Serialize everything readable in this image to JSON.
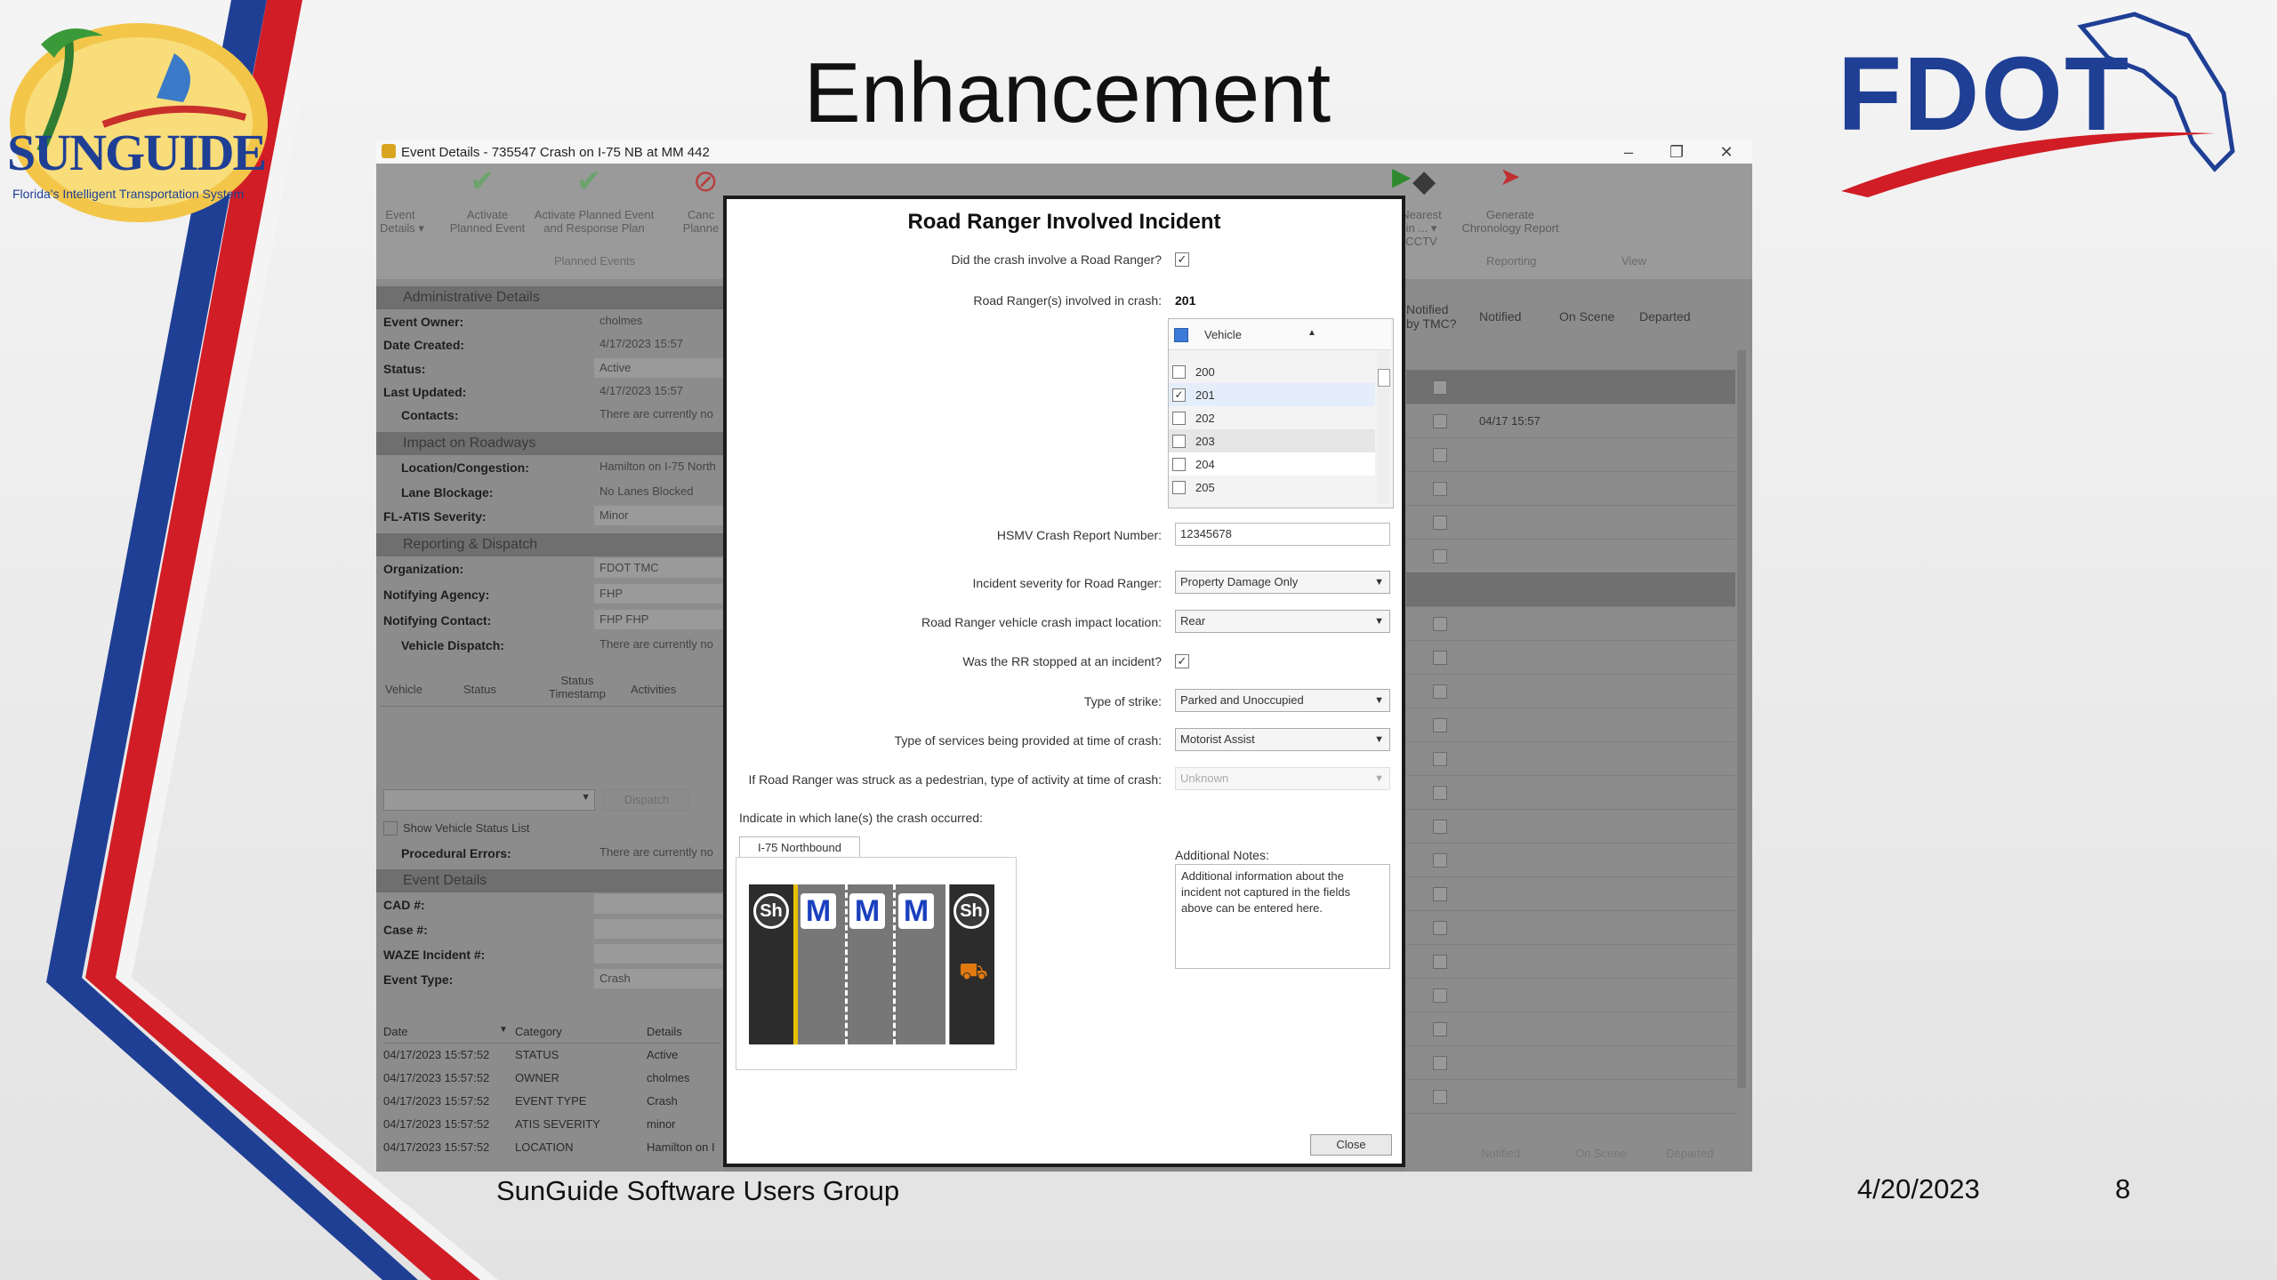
{
  "slide": {
    "title": "Enhancement",
    "footer_text": "SunGuide Software Users Group",
    "footer_date": "4/20/2023",
    "page_number": "8"
  },
  "logos": {
    "left_logo_text": "SUNGUIDE",
    "left_logo_tagline": "Florida's Intelligent Transportation System",
    "right_logo_text": "FDOT"
  },
  "window": {
    "title": "Event Details - 735547 Crash on I-75 NB at MM 442",
    "controls": [
      "–",
      "❐",
      "✕"
    ]
  },
  "ribbon": {
    "buttons": [
      {
        "label": "Event\nDetails ▾"
      },
      {
        "label": "Activate\nPlanned Event"
      },
      {
        "label": "Activate Planned Event\nand Response Plan"
      },
      {
        "label": "Canc\nPlanne"
      },
      {
        "label": "Nearest\nin ... ▾\nCCTV"
      },
      {
        "label": "Generate\nChronology Report"
      }
    ],
    "groups": [
      "Planned Events",
      "Reporting",
      "View"
    ]
  },
  "left_panel": {
    "sections": {
      "admin": "Administrative Details",
      "impact": "Impact on Roadways",
      "reporting": "Reporting & Dispatch",
      "event": "Event Details"
    },
    "admin_fields": [
      {
        "label": "Event Owner:",
        "value": "cholmes"
      },
      {
        "label": "Date Created:",
        "value": "4/17/2023 15:57"
      },
      {
        "label": "Status:",
        "value": "Active"
      },
      {
        "label": "Last Updated:",
        "value": "4/17/2023 15:57"
      },
      {
        "label": "Contacts:",
        "value": "There are currently no"
      }
    ],
    "impact_fields": [
      {
        "label": "Location/Congestion:",
        "value": "Hamilton on I-75 North"
      },
      {
        "label": "Lane Blockage:",
        "value": "No Lanes Blocked"
      },
      {
        "label": "FL-ATIS Severity:",
        "value": "Minor"
      }
    ],
    "reporting_fields": [
      {
        "label": "Organization:",
        "value": "FDOT TMC"
      },
      {
        "label": "Notifying Agency:",
        "value": "FHP"
      },
      {
        "label": "Notifying Contact:",
        "value": "FHP FHP"
      },
      {
        "label": "Vehicle Dispatch:",
        "value": "There are currently no"
      }
    ],
    "dispatch_columns": [
      "Vehicle",
      "Status",
      "Status\nTimestamp",
      "Activities"
    ],
    "dispatch_button": "Dispatch",
    "show_status_list": "Show Vehicle Status List",
    "procedural_errors": {
      "label": "Procedural Errors:",
      "value": "There are currently no"
    },
    "event_fields": [
      {
        "label": "CAD #:",
        "value": ""
      },
      {
        "label": "Case #:",
        "value": ""
      },
      {
        "label": "WAZE Incident #:",
        "value": ""
      },
      {
        "label": "Event Type:",
        "value": "Crash"
      }
    ],
    "chronology_columns": [
      "Date",
      "Category",
      "Details"
    ],
    "chronology_rows": [
      {
        "date": "04/17/2023 15:57:52",
        "category": "STATUS",
        "details": "Active"
      },
      {
        "date": "04/17/2023 15:57:52",
        "category": "OWNER",
        "details": "cholmes"
      },
      {
        "date": "04/17/2023 15:57:52",
        "category": "EVENT TYPE",
        "details": "Crash"
      },
      {
        "date": "04/17/2023 15:57:52",
        "category": "ATIS SEVERITY",
        "details": "minor"
      },
      {
        "date": "04/17/2023 15:57:52",
        "category": "LOCATION",
        "details": "Hamilton on I"
      }
    ]
  },
  "right_panel": {
    "columns": [
      "Notified\nby TMC?",
      "Notified",
      "On Scene",
      "Departed"
    ],
    "first_time": "04/17 15:57",
    "footer_buttons": [
      "Notified",
      "On Scene",
      "Departed"
    ]
  },
  "dialog": {
    "title": "Road Ranger Involved Incident",
    "q_involved": "Did the crash involve a Road Ranger?",
    "q_involved_checked": true,
    "rangers_label": "Road Ranger(s) involved in crash:",
    "rangers_value": "201",
    "vehicle_header": "Vehicle",
    "vehicles": [
      {
        "id": "200",
        "checked": false
      },
      {
        "id": "201",
        "checked": true
      },
      {
        "id": "202",
        "checked": false
      },
      {
        "id": "203",
        "checked": false
      },
      {
        "id": "204",
        "checked": false
      },
      {
        "id": "205",
        "checked": false
      }
    ],
    "hsmv_label": "HSMV Crash Report Number:",
    "hsmv_value": "12345678",
    "severity_label": "Incident severity for Road Ranger:",
    "severity_value": "Property Damage Only",
    "impact_label": "Road Ranger vehicle crash impact location:",
    "impact_value": "Rear",
    "stopped_label": "Was the RR stopped at an incident?",
    "stopped_checked": true,
    "strike_label": "Type of strike:",
    "strike_value": "Parked and Unoccupied",
    "services_label": "Type of services being provided at time of crash:",
    "services_value": "Motorist Assist",
    "pedestrian_label": "If Road Ranger was struck as a pedestrian, type of activity at time of crash:",
    "pedestrian_value": "Unknown",
    "lanes_label": "Indicate in which lane(s) the crash occurred:",
    "lane_tab": "I-75 Northbound",
    "lane_signs": [
      "Sh",
      "M",
      "M",
      "M",
      "Sh"
    ],
    "notes_label": "Additional Notes:",
    "notes_value": "Additional information about the incident not captured in the fields above can be entered here.",
    "close_button": "Close"
  }
}
